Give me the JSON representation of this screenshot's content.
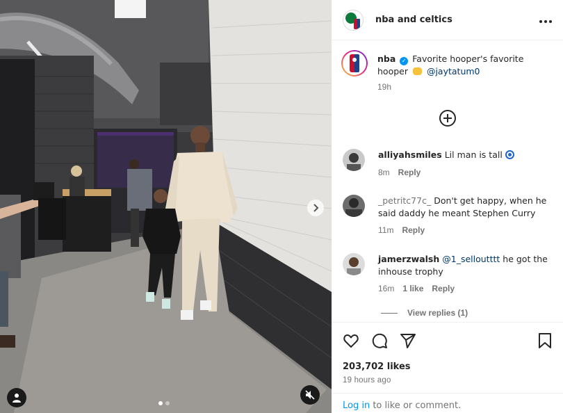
{
  "header": {
    "account": "nba and celtics",
    "more_icon": "more-horizontal-icon"
  },
  "caption": {
    "username": "nba",
    "text_before": "Favorite hooper's favorite hooper",
    "emoji": "handshake-emoji",
    "mention": "@jaytatum0",
    "time": "19h"
  },
  "add_icon": "add-circle-icon",
  "comments": [
    {
      "username": "alliyahsmiles",
      "text": "Lil man is tall",
      "emoji": "blue-eye-emoji",
      "time": "8m",
      "likes": "",
      "reply": "Reply"
    },
    {
      "username": "_petritc77c_",
      "text": "Don't get happy, when he said daddy he meant Stephen Curry",
      "time": "11m",
      "likes": "",
      "reply": "Reply"
    },
    {
      "username": "jamerzwalsh",
      "mention": "@1_selloutttt",
      "text": "he got the inhouse trophy",
      "time": "16m",
      "likes": "1 like",
      "reply": "Reply"
    }
  ],
  "view_replies": "View replies (1)",
  "actions": {
    "like_icon": "heart-icon",
    "comment_icon": "comment-icon",
    "share_icon": "send-icon",
    "save_icon": "bookmark-icon"
  },
  "likes": "203,702 likes",
  "posted": "19 hours ago",
  "login": {
    "link": "Log in",
    "rest": " to like or comment."
  },
  "media": {
    "next_icon": "chevron-right-icon",
    "tag_icon": "user-tag-icon",
    "mute_icon": "speaker-muted-icon",
    "carousel": {
      "count": 2,
      "active": 0
    }
  }
}
